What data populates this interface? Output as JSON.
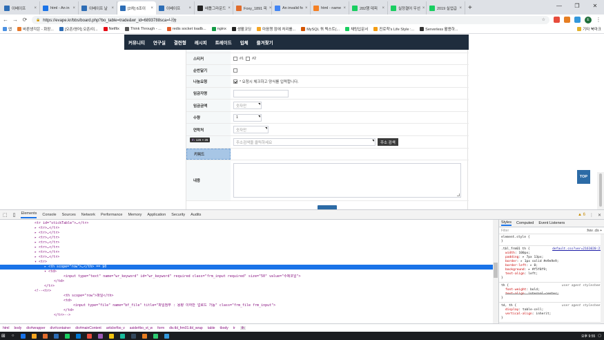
{
  "tabs": [
    {
      "label": "이베이프",
      "color": "#2d6db5"
    },
    {
      "label": "html - An in",
      "color": "#1a73e8"
    },
    {
      "label": "이베이프 날",
      "color": "#2d6db5"
    },
    {
      "label": "[2차] 6조이",
      "color": "#2d6db5",
      "active": true
    },
    {
      "label": "이베이프",
      "color": "#2d6db5"
    },
    {
      "label": "배틀그라운드",
      "color": "#222222"
    },
    {
      "label": "Foxy_1891 피",
      "color": "#e06c2c"
    },
    {
      "label": "An invalid fo",
      "color": "#4285f4"
    },
    {
      "label": "html - name",
      "color": "#f48024"
    },
    {
      "label": "282행 데피",
      "color": "#19ce60"
    },
    {
      "label": "실정결어 우선",
      "color": "#19ce60"
    },
    {
      "label": "2019 실업급",
      "color": "#19ce60"
    }
  ],
  "window_controls": {
    "minimize": "—",
    "maximize": "❐",
    "close": "✕"
  },
  "toolbar": {
    "back": "←",
    "forward": "→",
    "reload": "⟳",
    "lock": "🔒",
    "url": "https://evape.kr/bbs/board.php?bo_table=trade&wr_id=6893788sca=나눔",
    "avatar": "E"
  },
  "bookmarks": [
    {
      "label": "앱",
      "color": "#4a90e2"
    },
    {
      "label": "바른생각은 - 화장...",
      "color": "#e87a2b"
    },
    {
      "label": "[오픈/영어] 오픈/이...",
      "color": "#2d6db5"
    },
    {
      "label": "Netflix",
      "color": "#e50914"
    },
    {
      "label": "Think Through - ...",
      "color": "#555555"
    },
    {
      "label": "redis socket loadb...",
      "color": "#e25c2a"
    },
    {
      "label": "nginx",
      "color": "#149a46"
    },
    {
      "label": "생활코딩",
      "color": "#222222"
    },
    {
      "label": "마음챙 잠에 처리를...",
      "color": "#f5a623"
    },
    {
      "label": "MySQL 쿼 텍스트(...",
      "color": "#d35400"
    },
    {
      "label": "채팅입문서",
      "color": "#19ce60"
    },
    {
      "label": "진로착's Life Style :...",
      "color": "#f39c12"
    },
    {
      "label": "Serverless 활용하...",
      "color": "#333333"
    },
    {
      "label": "기타 북마크",
      "color": "#e1b12c"
    }
  ],
  "site_nav": [
    "커뮤니티",
    "연구실",
    "결련형",
    "레시피",
    "트레이드",
    "입체",
    "즐겨찾기"
  ],
  "form": {
    "sticker_label": "스티커",
    "sticker_opt1": "#1",
    "sticker_opt2": "#2",
    "immediate_label": "순번달기",
    "share_label": "나눔요청",
    "share_note": "* 요청시 체크하고 양식를 입력합니다.",
    "lender_label": "임금자명",
    "amount_label": "임금금액",
    "amount_placeholder": "숫자만",
    "qty_label": "수량",
    "qty_value": "1",
    "contact_label": "연락처",
    "contact_placeholder": "숫자만",
    "address_placeholder": "주소검색을 클릭하세요",
    "address_button": "주소 검색",
    "keyword_label": "키워드",
    "content_label": "내용"
  },
  "tooltip": {
    "tag": "th",
    "size": "126 × 26"
  },
  "top_button": "TOP",
  "devtools": {
    "tabs": [
      "Elements",
      "Console",
      "Sources",
      "Network",
      "Performance",
      "Memory",
      "Application",
      "Security",
      "Audits"
    ],
    "warnings": "▲ 6",
    "lines": [
      {
        "indent": 3,
        "text": "<tr id=\"stickTable\">…</tr>"
      },
      {
        "indent": 3,
        "text": "▸ <tr>…</tr>"
      },
      {
        "indent": 3,
        "text": "▸ <tr>…</tr>"
      },
      {
        "indent": 3,
        "text": "▸ <tr>…</tr>"
      },
      {
        "indent": 3,
        "text": "▸ <tr>…</tr>"
      },
      {
        "indent": 3,
        "text": "▸ <tr>…</tr>"
      },
      {
        "indent": 3,
        "text": "▸ <tr>…</tr>"
      },
      {
        "indent": 3,
        "text": "▸ <tr>…</tr>"
      },
      {
        "indent": 3,
        "text": "▾ <tr>"
      },
      {
        "indent": 4,
        "text": "▸ <th scope=\"row\">…</th> == $0",
        "selected": true
      },
      {
        "indent": 4,
        "text": "▾ <td>"
      },
      {
        "indent": 6,
        "text": "<input type=\"text\" name=\"wr_keyword\" id=\"wr_keyword\" required class=\"frm_input required\" size=\"50\" value=\"수제코일\">"
      },
      {
        "indent": 5,
        "text": "</td>"
      },
      {
        "indent": 4,
        "text": "</tr>"
      },
      {
        "indent": 3,
        "text": "<!--<tr>"
      },
      {
        "indent": 6,
        "text": "<th scope=\"row\">파일</th>"
      },
      {
        "indent": 6,
        "text": "<td>"
      },
      {
        "indent": 7,
        "text": "<input type=\"file\" name=\"bf_file\" title=\"파일첨부 : 용량 이하만 업로드 가능\" class=\"frm_file frm_input\">"
      },
      {
        "indent": 6,
        "text": "</td>"
      },
      {
        "indent": 5,
        "text": "</tr>-->"
      }
    ],
    "styles_tabs": [
      "Styles",
      "Computed",
      "Event Listeners"
    ],
    "filter_placeholder": "Filter",
    "filter_right": ":hov .cls +",
    "style_blocks": [
      {
        "selector": "element.style {",
        "source": "",
        "props": []
      },
      {
        "selector": ".tbl_frm01 th {",
        "source": "default.css?ver=2161020:22",
        "props": [
          [
            "width",
            "100px;"
          ],
          [
            "padding",
            "▸ 7px 13px;"
          ],
          [
            "border",
            "▸ 1px solid #e9e9e9;"
          ],
          [
            "border-left",
            "▸ 0;"
          ],
          [
            "background",
            "▸ #f5f8f9;"
          ],
          [
            "text-align",
            "left;"
          ]
        ]
      },
      {
        "selector": "th {",
        "source": "user agent stylesheet",
        "ua": true,
        "props": [
          [
            "font-weight",
            "bold;"
          ],
          [
            "text-align",
            "internal-center;",
            true
          ]
        ]
      },
      {
        "selector": "td, th {",
        "source": "user agent stylesheet",
        "ua": true,
        "props": [
          [
            "display",
            "table-cell;"
          ],
          [
            "vertical-align",
            "inherit;"
          ]
        ]
      }
    ],
    "breadcrumbs": [
      "html",
      "body",
      "div#wrapper",
      "div#container",
      "div#mainContent",
      "article#bo_v",
      "aside#bo_vt_w",
      "form",
      "div.tbl_frm01.tbl_wrap",
      "table",
      "tbody",
      "tr",
      "th"
    ]
  },
  "taskbar": {
    "icons": [
      "#1a73e8",
      "#f5a623",
      "#e06c2c",
      "#2d6db5",
      "#19ce60",
      "#0078d4",
      "#e74c3c",
      "#9b59b6",
      "#f1c40f",
      "#1abc9c",
      "#34495e",
      "#e67e22",
      "#2ecc71",
      "#3498db"
    ],
    "time": "오후 9:55"
  }
}
